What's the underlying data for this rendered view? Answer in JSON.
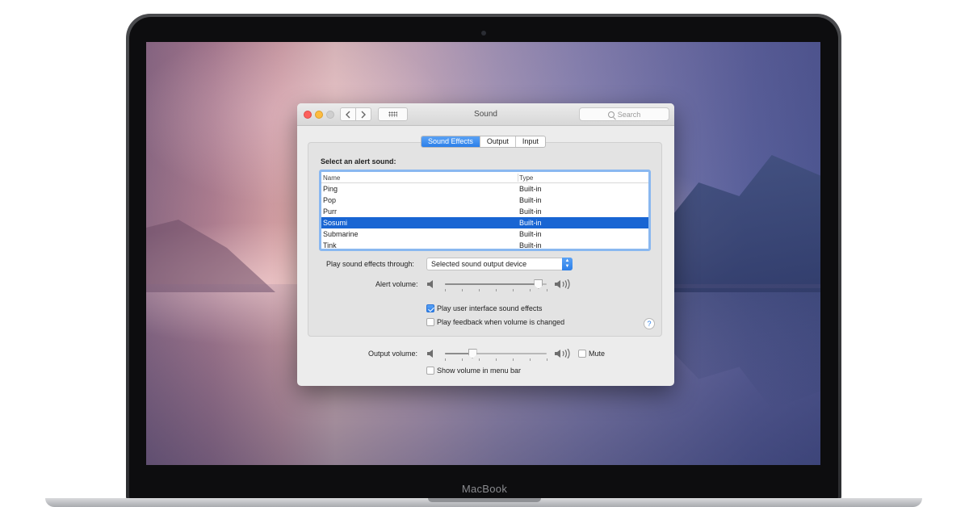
{
  "laptop": {
    "brand": "MacBook"
  },
  "window": {
    "title": "Sound",
    "search_placeholder": "Search",
    "tabs": [
      {
        "label": "Sound Effects",
        "active": true
      },
      {
        "label": "Output",
        "active": false
      },
      {
        "label": "Input",
        "active": false
      }
    ],
    "alert_heading": "Select an alert sound:",
    "table": {
      "columns": [
        "Name",
        "Type"
      ],
      "rows": [
        {
          "name": "Ping",
          "type": "Built-in",
          "selected": false
        },
        {
          "name": "Pop",
          "type": "Built-in",
          "selected": false
        },
        {
          "name": "Purr",
          "type": "Built-in",
          "selected": false
        },
        {
          "name": "Sosumi",
          "type": "Built-in",
          "selected": true
        },
        {
          "name": "Submarine",
          "type": "Built-in",
          "selected": false
        },
        {
          "name": "Tink",
          "type": "Built-in",
          "selected": false
        }
      ]
    },
    "play_through": {
      "label": "Play sound effects through:",
      "value": "Selected sound output device"
    },
    "alert_volume": {
      "label": "Alert volume:",
      "level_fraction": 0.92
    },
    "checkboxes": {
      "ui_effects": {
        "label": "Play user interface sound effects",
        "checked": true
      },
      "feedback": {
        "label": "Play feedback when volume is changed",
        "checked": false
      }
    },
    "help_label": "?",
    "output_volume": {
      "label": "Output volume:",
      "level_fraction": 0.27
    },
    "mute": {
      "label": "Mute",
      "checked": false
    },
    "menu_bar": {
      "label": "Show volume in menu bar",
      "checked": false
    }
  },
  "icons": {
    "close": "close-traffic-light",
    "minimize": "minimize-traffic-light",
    "zoom": "zoom-traffic-light",
    "back": "chevron-left-icon",
    "forward": "chevron-right-icon",
    "grid": "grid-icon",
    "search": "search-icon",
    "speaker_low": "speaker-low-icon",
    "speaker_high": "speaker-high-icon"
  },
  "colors": {
    "accent": "#2b7fe9",
    "selection": "#1865d3",
    "close_light": "#fc605c",
    "minimize_light": "#fdbc40",
    "zoom_light": "#cfcfcf"
  }
}
